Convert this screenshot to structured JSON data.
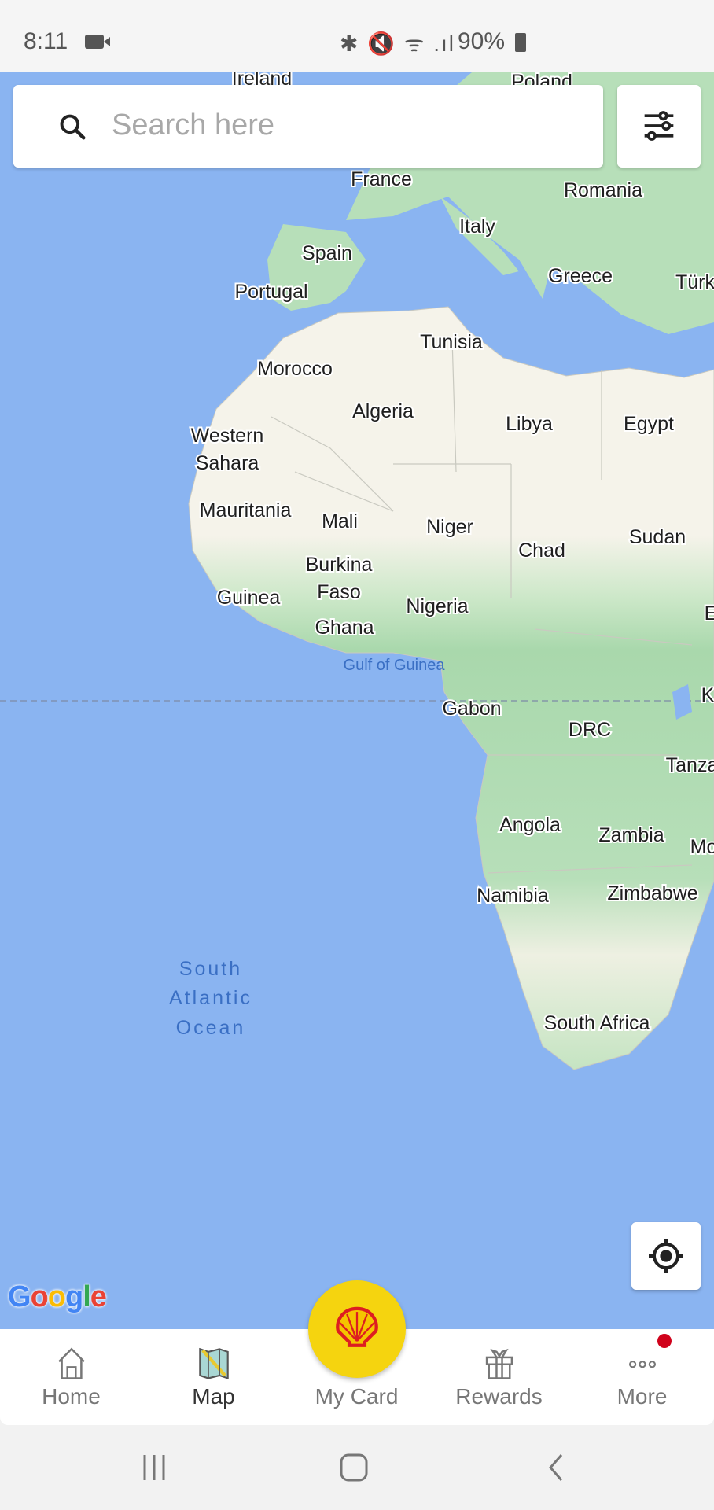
{
  "status_bar": {
    "time": "8:11",
    "icons_text": "✱ 🔇 ᯤ .ıl",
    "battery": "90%"
  },
  "search": {
    "placeholder": "Search here"
  },
  "map": {
    "labels": {
      "ireland": "Ireland",
      "poland": "Poland",
      "france": "France",
      "romania": "Romania",
      "italy": "Italy",
      "spain": "Spain",
      "greece": "Greece",
      "turkey": "Türk",
      "portugal": "Portugal",
      "tunisia": "Tunisia",
      "morocco": "Morocco",
      "algeria": "Algeria",
      "libya": "Libya",
      "egypt": "Egypt",
      "western_sahara_1": "Western",
      "western_sahara_2": "Sahara",
      "mauritania": "Mauritania",
      "mali": "Mali",
      "niger": "Niger",
      "chad": "Chad",
      "sudan": "Sudan",
      "burkina_1": "Burkina",
      "burkina_2": "Faso",
      "guinea": "Guinea",
      "nigeria": "Nigeria",
      "ghana": "Ghana",
      "gulf_of_guinea": "Gulf of Guinea",
      "gabon": "Gabon",
      "drc": "DRC",
      "tanzania": "Tanza",
      "angola": "Angola",
      "zambia": "Zambia",
      "mozambique": "Mo",
      "namibia": "Namibia",
      "zimbabwe": "Zimbabwe",
      "south_africa": "South Africa",
      "ocean_1": "South",
      "ocean_2": "Atlantic",
      "ocean_3": "Ocean",
      "kenya": "K",
      "ethiopia": "E"
    },
    "attribution": "Google",
    "colors": {
      "water": "#8ab4f1",
      "desert": "#f5f3ea",
      "vegetation": "#b7dfb9"
    }
  },
  "bottom_nav": {
    "items": [
      {
        "label": "Home"
      },
      {
        "label": "Map"
      },
      {
        "label": "My Card"
      },
      {
        "label": "Rewards"
      },
      {
        "label": "More"
      }
    ],
    "active": "Map",
    "fab_color": "#f5d40f",
    "notification_color": "#d0021b"
  }
}
